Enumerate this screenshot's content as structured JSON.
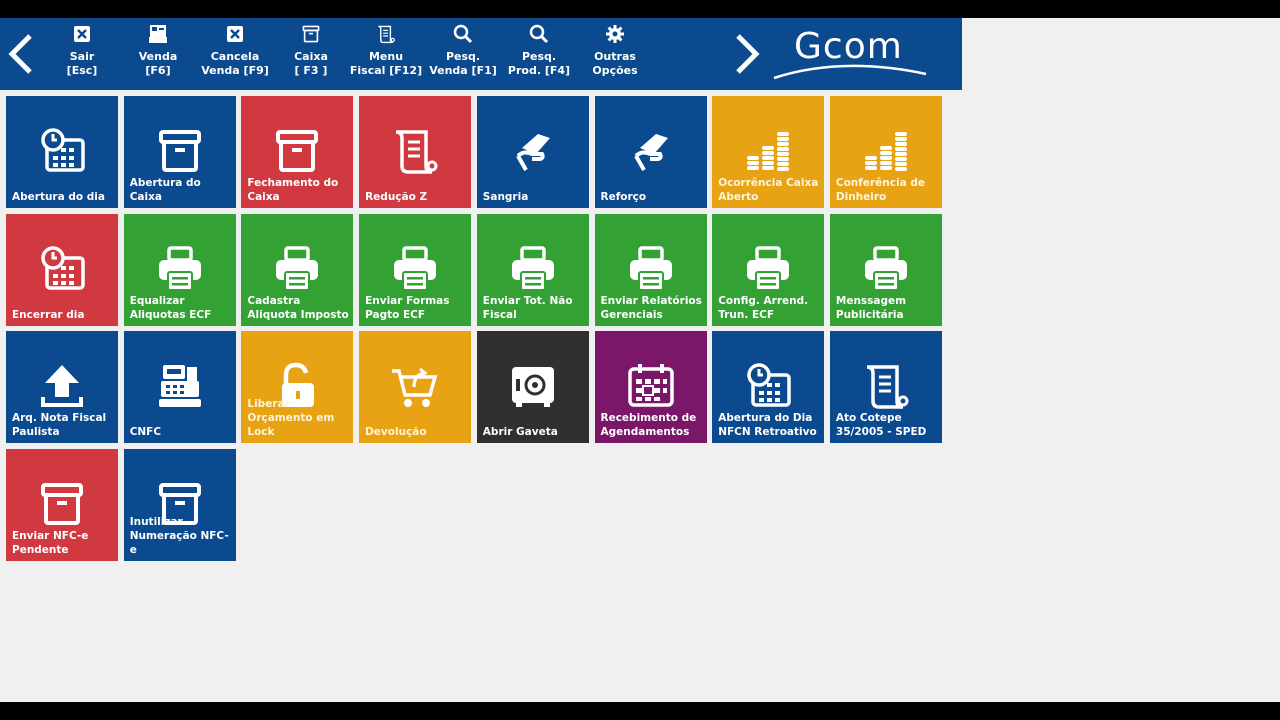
{
  "toolbar": {
    "back_label": "Voltar",
    "forward_label": "Avançar",
    "buttons": [
      {
        "label": "Sair\n[Esc]",
        "icon": "close-icon"
      },
      {
        "label": "Venda\n[F6]",
        "icon": "register-icon"
      },
      {
        "label": "Cancela\nVenda [F9]",
        "icon": "close-icon"
      },
      {
        "label": "Caixa\n[ F3 ]",
        "icon": "box-icon"
      },
      {
        "label": "Menu\nFiscal [F12]",
        "icon": "scroll-icon"
      },
      {
        "label": "Pesq.\nVenda [F1]",
        "icon": "search-icon"
      },
      {
        "label": "Pesq.\nProd. [F4]",
        "icon": "search-icon"
      },
      {
        "label": "Outras\nOpções",
        "icon": "gear-icon"
      }
    ],
    "logo": "Gcom",
    "color": "#0b4a8f"
  },
  "tiles": [
    {
      "label": "Abertura do dia",
      "color": "blue",
      "icon": "calendar-clock-icon"
    },
    {
      "label": "Abertura do Caixa",
      "color": "blue",
      "icon": "box-icon"
    },
    {
      "label": "Fechamento do Caixa",
      "color": "red",
      "icon": "box-icon"
    },
    {
      "label": "Redução Z",
      "color": "red",
      "icon": "scroll-icon"
    },
    {
      "label": "Sangria",
      "color": "blue",
      "icon": "hand-money-icon"
    },
    {
      "label": "Reforço",
      "color": "blue",
      "icon": "hand-money-icon"
    },
    {
      "label": "Ocorrência Caixa Aberto",
      "color": "orange",
      "icon": "coins-icon"
    },
    {
      "label": "Conferência de Dinheiro",
      "color": "orange",
      "icon": "coins-icon"
    },
    {
      "label": "Encerrar dia",
      "color": "red",
      "icon": "calendar-clock-icon"
    },
    {
      "label": "Equalizar Aliquotas ECF",
      "color": "green",
      "icon": "printer-icon"
    },
    {
      "label": "Cadastra Aliquota Imposto",
      "color": "green",
      "icon": "printer-icon"
    },
    {
      "label": "Enviar Formas Pagto ECF",
      "color": "green",
      "icon": "printer-icon"
    },
    {
      "label": "Enviar Tot. Não Fiscal",
      "color": "green",
      "icon": "printer-icon"
    },
    {
      "label": "Enviar Relatórios Gerenciais",
      "color": "green",
      "icon": "printer-icon"
    },
    {
      "label": "Config. Arrend. Trun. ECF",
      "color": "green",
      "icon": "printer-icon"
    },
    {
      "label": "Menssagem Publicitária",
      "color": "green",
      "icon": "printer-icon"
    },
    {
      "label": "Arq. Nota Fiscal Paulista",
      "color": "blue",
      "icon": "upload-icon"
    },
    {
      "label": "CNFC",
      "color": "blue",
      "icon": "cash-register-icon"
    },
    {
      "label": "Liberar Orçamento em Lock",
      "color": "orange",
      "icon": "unlock-icon"
    },
    {
      "label": "Devolução",
      "color": "orange",
      "icon": "cart-return-icon"
    },
    {
      "label": "Abrir Gaveta",
      "color": "dark",
      "icon": "safe-icon"
    },
    {
      "label": "Recebimento de Agendamentos",
      "color": "purple",
      "icon": "calendar-icon"
    },
    {
      "label": "Abertura do Dia NFCN Retroativo",
      "color": "blue",
      "icon": "calendar-clock-icon"
    },
    {
      "label": "Ato Cotepe 35/2005 - SPED",
      "color": "blue",
      "icon": "scroll-icon"
    },
    {
      "label": "Enviar NFC-e Pendente",
      "color": "red",
      "icon": "box-icon"
    },
    {
      "label": "Inutilizar Numeração NFC-e",
      "color": "blue",
      "icon": "box-icon"
    }
  ]
}
